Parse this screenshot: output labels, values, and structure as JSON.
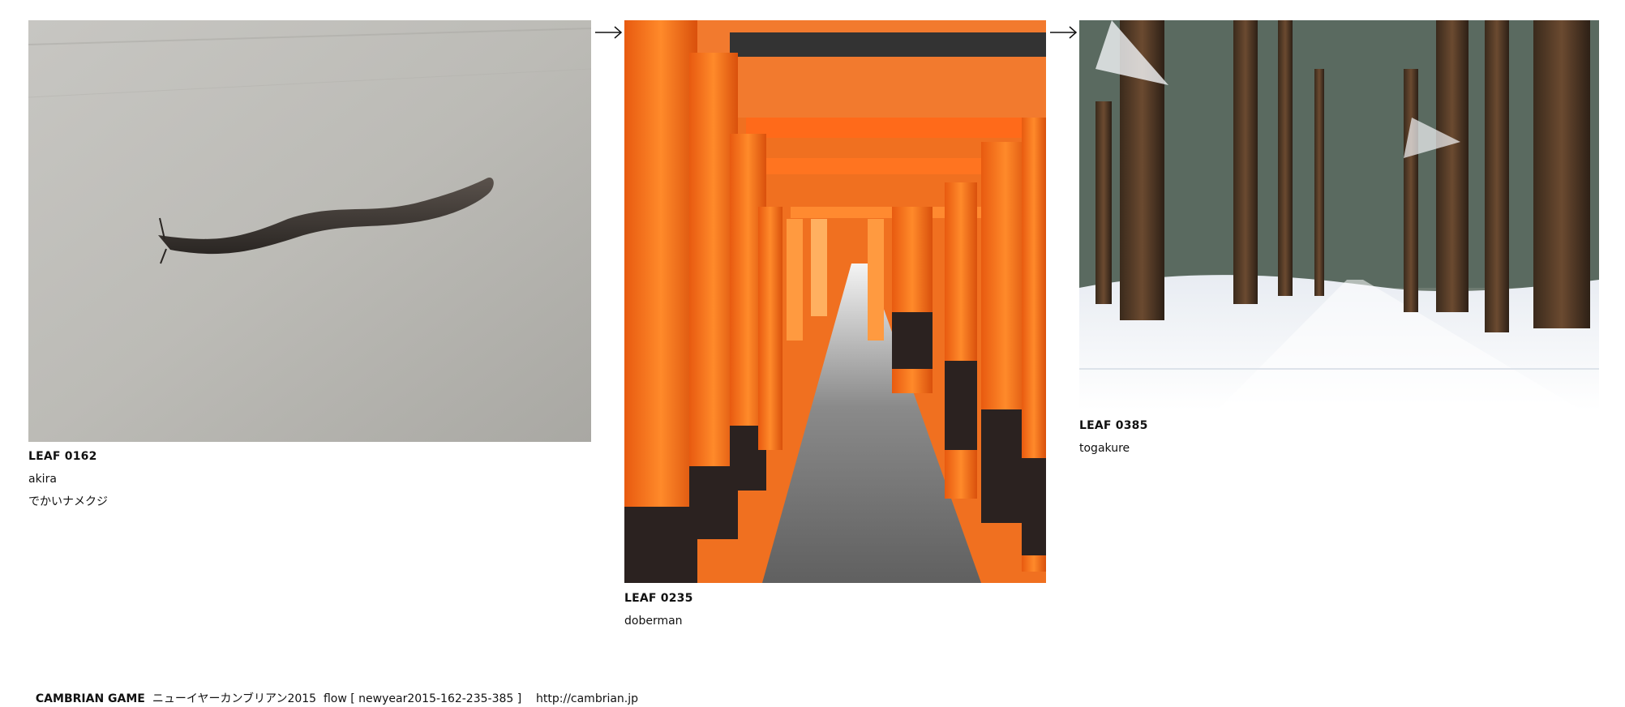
{
  "leaves": [
    {
      "title": "LEAF 0162",
      "author": "akira",
      "caption": "でかいナメクジ",
      "image": {
        "subject": "slug on concrete wall",
        "icon": "photo-slug"
      }
    },
    {
      "title": "LEAF 0235",
      "author": "doberman",
      "image": {
        "subject": "orange torii gate tunnel",
        "icon": "photo-torii"
      }
    },
    {
      "title": "LEAF 0385",
      "author": "togakure",
      "image": {
        "subject": "snowy cedar forest path",
        "icon": "photo-snow-forest"
      }
    }
  ],
  "arrows": [
    "arrow-right-icon",
    "arrow-right-icon"
  ],
  "footer": {
    "brand": "CAMBRIAN GAME",
    "text": "ニューイヤーカンブリアン2015  flow [ newyear2015-162-235-385 ]    http://cambrian.jp"
  },
  "colors": {
    "background": "#ffffff",
    "text": "#111111",
    "torii_orange": "#f06a12",
    "concrete": "#bdbcb7",
    "snow": "#f3f5f8"
  }
}
